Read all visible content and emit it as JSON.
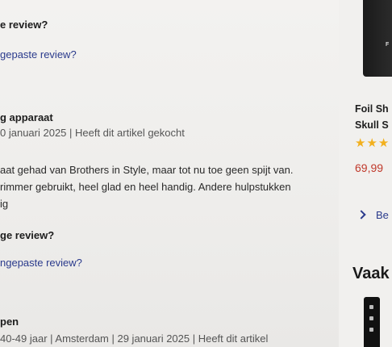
{
  "reviews": [
    {
      "question": "e review?",
      "report_link": "gepaste review?"
    },
    {
      "title": "g apparaat",
      "meta": "0 januari 2025 | Heeft dit artikel gekocht",
      "body": [
        "aat gehad van Brothers in Style, maar tot nu toe geen spijt van.",
        "rimmer gebruikt, heel glad en heel handig. Andere hulpstukken",
        "ig"
      ],
      "question": "ge review?",
      "report_link": "ngepaste review?"
    },
    {
      "title": "pen",
      "meta": "40-49 jaar | Amsterdam | 29 januari 2025 | Heeft dit artikel"
    }
  ],
  "sidebar": {
    "product_logo": "F",
    "product_name_line1": "Foil Sh",
    "product_name_line2": "Skull S",
    "stars": "★★★",
    "price": "69,99",
    "more_link": "Be",
    "section_title": "Vaak"
  },
  "colors": {
    "link": "#2a3a8c",
    "price": "#c0392b",
    "star": "#f2b01e"
  },
  "icons": {
    "more_link_icon": "chevron-right-icon"
  }
}
